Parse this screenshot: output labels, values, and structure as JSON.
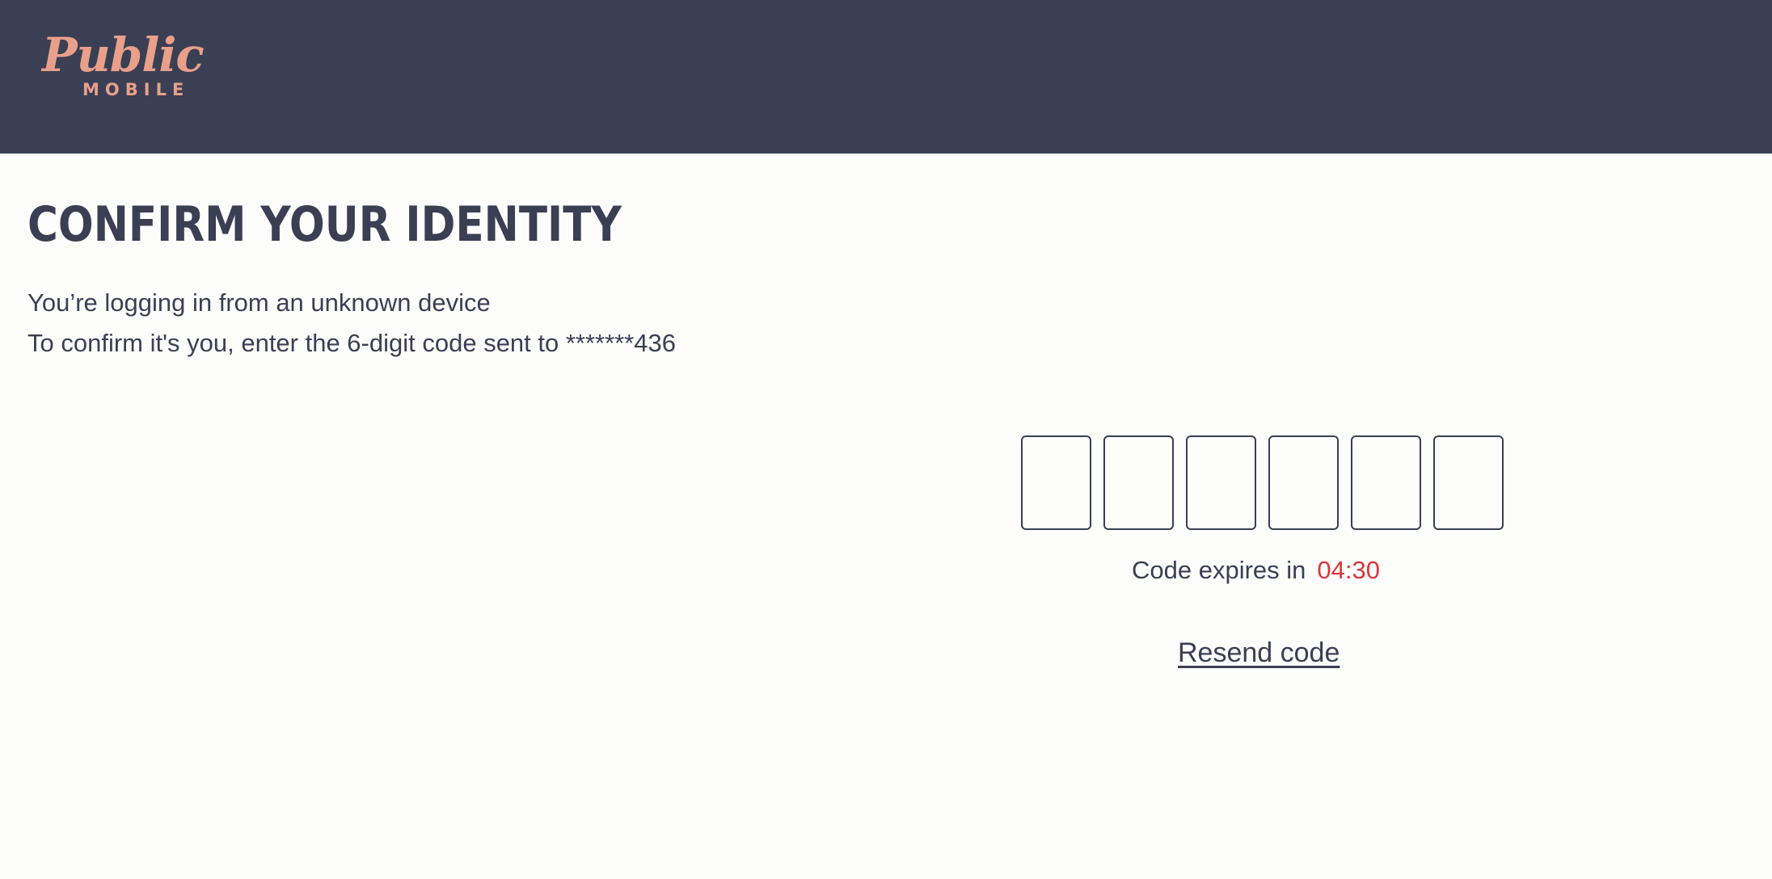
{
  "header": {
    "logo": {
      "main": "Public",
      "sub": "MOBILE"
    }
  },
  "main": {
    "title": "CONFIRM YOUR IDENTITY",
    "subtitle_line1": "You’re logging in from an unknown device",
    "subtitle_line2": "To confirm it's you, enter the 6-digit code  sent to *******436"
  },
  "code_entry": {
    "digits": [
      "",
      "",
      "",
      "",
      "",
      ""
    ]
  },
  "expiry": {
    "label": "Code expires in",
    "timer": "04:30"
  },
  "resend": {
    "label": "Resend code"
  },
  "colors": {
    "header_bg": "#3a3f54",
    "brand_accent": "#e8a08a",
    "text": "#3a3f54",
    "timer": "#d9363e",
    "page_bg": "#fdfdfb"
  }
}
